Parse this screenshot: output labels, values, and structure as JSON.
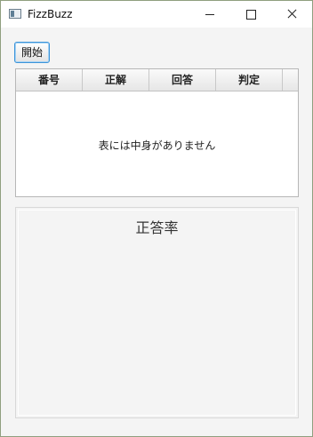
{
  "window": {
    "title": "FizzBuzz",
    "icon": "app-window-icon",
    "controls": [
      "minimize-icon",
      "maximize-icon",
      "close-icon"
    ]
  },
  "toolbar": {
    "start_label": "開始"
  },
  "table": {
    "columns": [
      "番号",
      "正解",
      "回答",
      "判定"
    ],
    "rows": [],
    "empty_message": "表には中身がありません"
  },
  "chart": {
    "title": "正答率"
  }
}
